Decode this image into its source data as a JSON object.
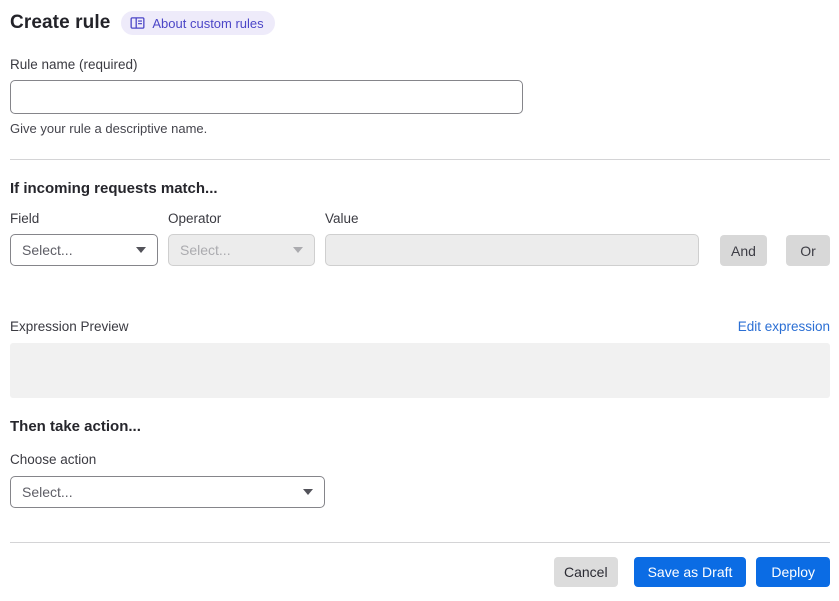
{
  "page": {
    "title": "Create rule",
    "about_badge": "About custom rules"
  },
  "rule_name": {
    "label": "Rule name (required)",
    "value": "",
    "helper": "Give your rule a descriptive name."
  },
  "match_section": {
    "heading": "If incoming requests match...",
    "field": {
      "label": "Field",
      "placeholder": "Select..."
    },
    "operator": {
      "label": "Operator",
      "placeholder": "Select..."
    },
    "value": {
      "label": "Value",
      "value": ""
    },
    "and_button": "And",
    "or_button": "Or"
  },
  "expression": {
    "label": "Expression Preview",
    "edit_link": "Edit expression",
    "content": ""
  },
  "action_section": {
    "heading": "Then take action...",
    "choose_label": "Choose action",
    "placeholder": "Select..."
  },
  "footer": {
    "cancel": "Cancel",
    "save_draft": "Save as Draft",
    "deploy": "Deploy"
  },
  "colors": {
    "primary_blue": "#0b6ce4",
    "link_blue": "#2b6fd4",
    "badge_bg": "#eeebfa",
    "badge_text": "#4c46c7",
    "disabled_bg": "#ececec",
    "secondary_gray": "#d8d8d8"
  }
}
